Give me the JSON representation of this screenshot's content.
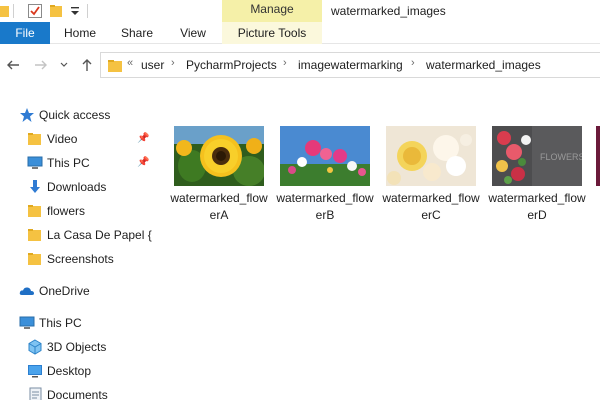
{
  "titlebar": {
    "manage_label": "Manage",
    "window_title": "watermarked_images"
  },
  "ribbon": {
    "tabs": [
      "File",
      "Home",
      "Share",
      "View",
      "Picture Tools"
    ]
  },
  "address": {
    "overflow": "«",
    "crumbs": [
      "user",
      "PycharmProjects",
      "imagewatermarking",
      "watermarked_images"
    ]
  },
  "nav": {
    "items": [
      {
        "label": "Quick access",
        "icon": "star-icon"
      },
      {
        "label": "Video",
        "icon": "folder-icon",
        "pinned": true
      },
      {
        "label": "This PC",
        "icon": "computer-icon",
        "pinned": true
      },
      {
        "label": "Downloads",
        "icon": "download-arrow-icon"
      },
      {
        "label": "flowers",
        "icon": "folder-icon"
      },
      {
        "label": "La Casa De Papel {M",
        "icon": "folder-icon"
      },
      {
        "label": "Screenshots",
        "icon": "folder-icon"
      },
      {
        "label": "OneDrive",
        "icon": "cloud-icon"
      },
      {
        "label": "This PC",
        "icon": "computer-icon"
      },
      {
        "label": "3D Objects",
        "icon": "cube-icon"
      },
      {
        "label": "Desktop",
        "icon": "desktop-icon"
      },
      {
        "label": "Documents",
        "icon": "documents-icon"
      }
    ]
  },
  "files": [
    {
      "name": "watermarked_flowerA",
      "thumb": "sunflower-thumbnail"
    },
    {
      "name": "watermarked_flowerB",
      "thumb": "pink-flowers-thumbnail"
    },
    {
      "name": "watermarked_flowerC",
      "thumb": "roses-thumbnail"
    },
    {
      "name": "watermarked_flowerD",
      "thumb": "flowers-dark-thumbnail",
      "watermark": "FLOWERS"
    }
  ],
  "colors": {
    "file_tab": "#1979ca",
    "manage_tab": "#f5f0a8"
  }
}
